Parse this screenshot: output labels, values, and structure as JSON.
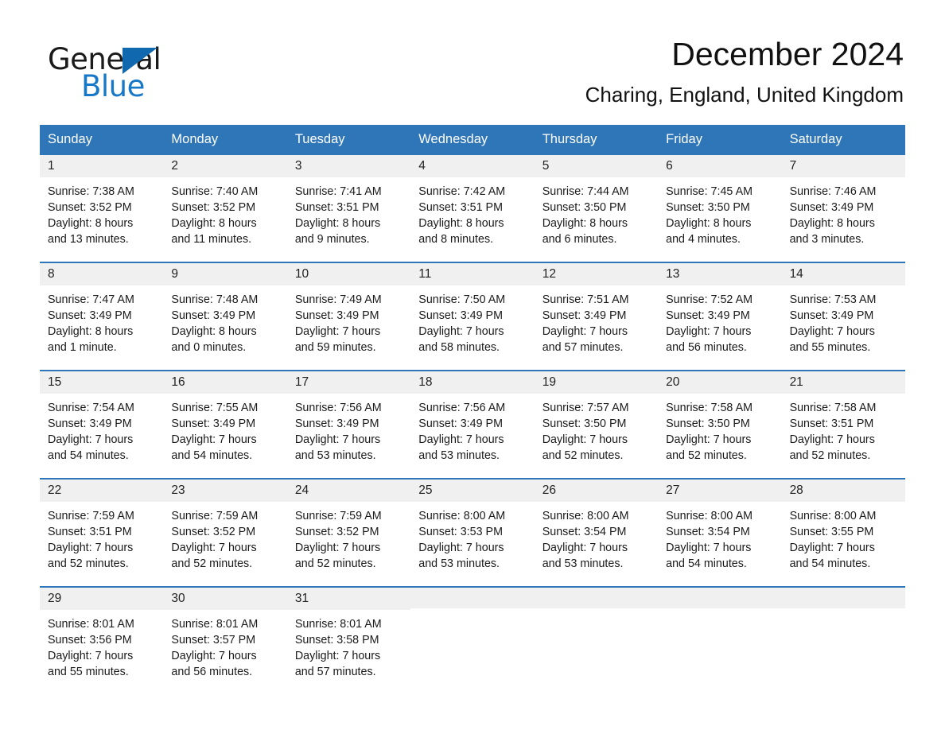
{
  "brand": {
    "name_part1": "General",
    "name_part2": "Blue",
    "triangle_color": "#1069ae",
    "blue_color": "#1878c8"
  },
  "header": {
    "title": "December 2024",
    "subtitle": "Charing, England, United Kingdom"
  },
  "theme": {
    "header_blue": "#2f76b8",
    "day_band_gray": "#f0f0f0",
    "text_black": "#1a1a1a"
  },
  "weekdays": [
    "Sunday",
    "Monday",
    "Tuesday",
    "Wednesday",
    "Thursday",
    "Friday",
    "Saturday"
  ],
  "weeks": [
    [
      {
        "day": "1",
        "sunrise": "Sunrise: 7:38 AM",
        "sunset": "Sunset: 3:52 PM",
        "daylight_line1": "Daylight: 8 hours",
        "daylight_line2": "and 13 minutes."
      },
      {
        "day": "2",
        "sunrise": "Sunrise: 7:40 AM",
        "sunset": "Sunset: 3:52 PM",
        "daylight_line1": "Daylight: 8 hours",
        "daylight_line2": "and 11 minutes."
      },
      {
        "day": "3",
        "sunrise": "Sunrise: 7:41 AM",
        "sunset": "Sunset: 3:51 PM",
        "daylight_line1": "Daylight: 8 hours",
        "daylight_line2": "and 9 minutes."
      },
      {
        "day": "4",
        "sunrise": "Sunrise: 7:42 AM",
        "sunset": "Sunset: 3:51 PM",
        "daylight_line1": "Daylight: 8 hours",
        "daylight_line2": "and 8 minutes."
      },
      {
        "day": "5",
        "sunrise": "Sunrise: 7:44 AM",
        "sunset": "Sunset: 3:50 PM",
        "daylight_line1": "Daylight: 8 hours",
        "daylight_line2": "and 6 minutes."
      },
      {
        "day": "6",
        "sunrise": "Sunrise: 7:45 AM",
        "sunset": "Sunset: 3:50 PM",
        "daylight_line1": "Daylight: 8 hours",
        "daylight_line2": "and 4 minutes."
      },
      {
        "day": "7",
        "sunrise": "Sunrise: 7:46 AM",
        "sunset": "Sunset: 3:49 PM",
        "daylight_line1": "Daylight: 8 hours",
        "daylight_line2": "and 3 minutes."
      }
    ],
    [
      {
        "day": "8",
        "sunrise": "Sunrise: 7:47 AM",
        "sunset": "Sunset: 3:49 PM",
        "daylight_line1": "Daylight: 8 hours",
        "daylight_line2": "and 1 minute."
      },
      {
        "day": "9",
        "sunrise": "Sunrise: 7:48 AM",
        "sunset": "Sunset: 3:49 PM",
        "daylight_line1": "Daylight: 8 hours",
        "daylight_line2": "and 0 minutes."
      },
      {
        "day": "10",
        "sunrise": "Sunrise: 7:49 AM",
        "sunset": "Sunset: 3:49 PM",
        "daylight_line1": "Daylight: 7 hours",
        "daylight_line2": "and 59 minutes."
      },
      {
        "day": "11",
        "sunrise": "Sunrise: 7:50 AM",
        "sunset": "Sunset: 3:49 PM",
        "daylight_line1": "Daylight: 7 hours",
        "daylight_line2": "and 58 minutes."
      },
      {
        "day": "12",
        "sunrise": "Sunrise: 7:51 AM",
        "sunset": "Sunset: 3:49 PM",
        "daylight_line1": "Daylight: 7 hours",
        "daylight_line2": "and 57 minutes."
      },
      {
        "day": "13",
        "sunrise": "Sunrise: 7:52 AM",
        "sunset": "Sunset: 3:49 PM",
        "daylight_line1": "Daylight: 7 hours",
        "daylight_line2": "and 56 minutes."
      },
      {
        "day": "14",
        "sunrise": "Sunrise: 7:53 AM",
        "sunset": "Sunset: 3:49 PM",
        "daylight_line1": "Daylight: 7 hours",
        "daylight_line2": "and 55 minutes."
      }
    ],
    [
      {
        "day": "15",
        "sunrise": "Sunrise: 7:54 AM",
        "sunset": "Sunset: 3:49 PM",
        "daylight_line1": "Daylight: 7 hours",
        "daylight_line2": "and 54 minutes."
      },
      {
        "day": "16",
        "sunrise": "Sunrise: 7:55 AM",
        "sunset": "Sunset: 3:49 PM",
        "daylight_line1": "Daylight: 7 hours",
        "daylight_line2": "and 54 minutes."
      },
      {
        "day": "17",
        "sunrise": "Sunrise: 7:56 AM",
        "sunset": "Sunset: 3:49 PM",
        "daylight_line1": "Daylight: 7 hours",
        "daylight_line2": "and 53 minutes."
      },
      {
        "day": "18",
        "sunrise": "Sunrise: 7:56 AM",
        "sunset": "Sunset: 3:49 PM",
        "daylight_line1": "Daylight: 7 hours",
        "daylight_line2": "and 53 minutes."
      },
      {
        "day": "19",
        "sunrise": "Sunrise: 7:57 AM",
        "sunset": "Sunset: 3:50 PM",
        "daylight_line1": "Daylight: 7 hours",
        "daylight_line2": "and 52 minutes."
      },
      {
        "day": "20",
        "sunrise": "Sunrise: 7:58 AM",
        "sunset": "Sunset: 3:50 PM",
        "daylight_line1": "Daylight: 7 hours",
        "daylight_line2": "and 52 minutes."
      },
      {
        "day": "21",
        "sunrise": "Sunrise: 7:58 AM",
        "sunset": "Sunset: 3:51 PM",
        "daylight_line1": "Daylight: 7 hours",
        "daylight_line2": "and 52 minutes."
      }
    ],
    [
      {
        "day": "22",
        "sunrise": "Sunrise: 7:59 AM",
        "sunset": "Sunset: 3:51 PM",
        "daylight_line1": "Daylight: 7 hours",
        "daylight_line2": "and 52 minutes."
      },
      {
        "day": "23",
        "sunrise": "Sunrise: 7:59 AM",
        "sunset": "Sunset: 3:52 PM",
        "daylight_line1": "Daylight: 7 hours",
        "daylight_line2": "and 52 minutes."
      },
      {
        "day": "24",
        "sunrise": "Sunrise: 7:59 AM",
        "sunset": "Sunset: 3:52 PM",
        "daylight_line1": "Daylight: 7 hours",
        "daylight_line2": "and 52 minutes."
      },
      {
        "day": "25",
        "sunrise": "Sunrise: 8:00 AM",
        "sunset": "Sunset: 3:53 PM",
        "daylight_line1": "Daylight: 7 hours",
        "daylight_line2": "and 53 minutes."
      },
      {
        "day": "26",
        "sunrise": "Sunrise: 8:00 AM",
        "sunset": "Sunset: 3:54 PM",
        "daylight_line1": "Daylight: 7 hours",
        "daylight_line2": "and 53 minutes."
      },
      {
        "day": "27",
        "sunrise": "Sunrise: 8:00 AM",
        "sunset": "Sunset: 3:54 PM",
        "daylight_line1": "Daylight: 7 hours",
        "daylight_line2": "and 54 minutes."
      },
      {
        "day": "28",
        "sunrise": "Sunrise: 8:00 AM",
        "sunset": "Sunset: 3:55 PM",
        "daylight_line1": "Daylight: 7 hours",
        "daylight_line2": "and 54 minutes."
      }
    ],
    [
      {
        "day": "29",
        "sunrise": "Sunrise: 8:01 AM",
        "sunset": "Sunset: 3:56 PM",
        "daylight_line1": "Daylight: 7 hours",
        "daylight_line2": "and 55 minutes."
      },
      {
        "day": "30",
        "sunrise": "Sunrise: 8:01 AM",
        "sunset": "Sunset: 3:57 PM",
        "daylight_line1": "Daylight: 7 hours",
        "daylight_line2": "and 56 minutes."
      },
      {
        "day": "31",
        "sunrise": "Sunrise: 8:01 AM",
        "sunset": "Sunset: 3:58 PM",
        "daylight_line1": "Daylight: 7 hours",
        "daylight_line2": "and 57 minutes."
      },
      {
        "day": "",
        "sunrise": "",
        "sunset": "",
        "daylight_line1": "",
        "daylight_line2": ""
      },
      {
        "day": "",
        "sunrise": "",
        "sunset": "",
        "daylight_line1": "",
        "daylight_line2": ""
      },
      {
        "day": "",
        "sunrise": "",
        "sunset": "",
        "daylight_line1": "",
        "daylight_line2": ""
      },
      {
        "day": "",
        "sunrise": "",
        "sunset": "",
        "daylight_line1": "",
        "daylight_line2": ""
      }
    ]
  ]
}
